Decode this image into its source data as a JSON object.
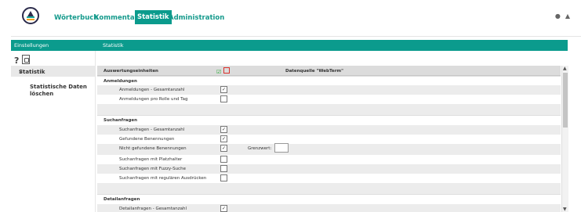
{
  "nav": {
    "items": [
      "Wörterbuch",
      "Kommentare",
      "Statistik",
      "Administration"
    ],
    "active": "Statistik"
  },
  "header": {
    "left": "Einstellungen",
    "right": "Statistik"
  },
  "toolbar": {
    "help": "?",
    "pdf_icon": "pdf-icon"
  },
  "sidebar": {
    "items": [
      {
        "label": "Statistik",
        "active": true
      },
      {
        "label": "Statistische Daten löschen",
        "active": false
      }
    ]
  },
  "table": {
    "header_label": "Auswertungseinheiten",
    "source_label": "Datenquelle \"WebTerm\"",
    "sections": [
      {
        "title": "Anmeldungen",
        "rows": [
          {
            "label": "Anmeldungen - Gesamtanzahl",
            "checked": true
          },
          {
            "label": "Anmeldungen pro Rolle und Tag",
            "checked": false
          }
        ]
      },
      {
        "title": "Suchanfragen",
        "rows": [
          {
            "label": "Suchanfragen - Gesamtanzahl",
            "checked": true
          },
          {
            "label": "Gefundene Benennungen",
            "checked": true
          },
          {
            "label": "Nicht gefundene Benennungen",
            "checked": true,
            "extra": "Grenzwert:"
          },
          {
            "label": "Suchanfragen mit Platzhalter",
            "checked": false
          },
          {
            "label": "Suchanfragen mit Fuzzy-Suche",
            "checked": false
          },
          {
            "label": "Suchanfragen mit regulären Ausdrücken",
            "checked": false
          }
        ]
      },
      {
        "title": "Detailanfragen",
        "rows": [
          {
            "label": "Detailanfragen - Gesamtanzahl",
            "checked": true
          }
        ]
      }
    ]
  }
}
